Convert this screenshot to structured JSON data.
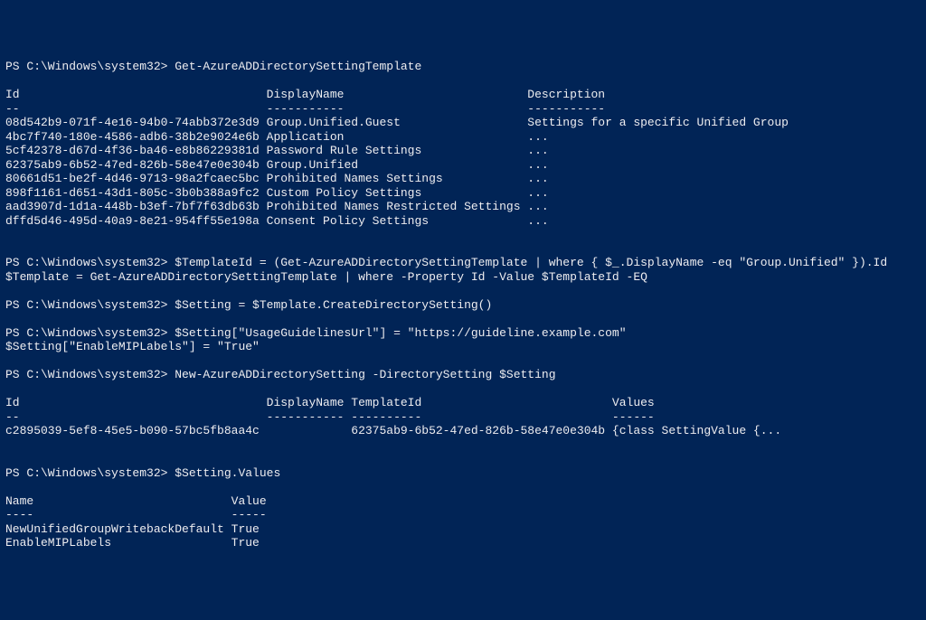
{
  "prompt": "PS C:\\Windows\\system32>",
  "cmd": {
    "c1": "Get-AzureADDirectorySettingTemplate",
    "c2a": "$TemplateId = (Get-AzureADDirectorySettingTemplate | where { $_.DisplayName -eq \"Group.Unified\" }).Id",
    "c2b": "$Template = Get-AzureADDirectorySettingTemplate | where -Property Id -Value $TemplateId -EQ",
    "c3": "$Setting = $Template.CreateDirectorySetting()",
    "c4a": "$Setting[\"UsageGuidelinesUrl\"] = \"https://guideline.example.com\"",
    "c4b": "$Setting[\"EnableMIPLabels\"] = \"True\"",
    "c5": "New-AzureADDirectorySetting -DirectorySetting $Setting",
    "c6": "$Setting.Values"
  },
  "table1": {
    "headers": {
      "id": "Id",
      "dn": "DisplayName",
      "desc": "Description"
    },
    "rows": [
      {
        "id": "08d542b9-071f-4e16-94b0-74abb372e3d9",
        "dn": "Group.Unified.Guest",
        "desc": "Settings for a specific Unified Group"
      },
      {
        "id": "4bc7f740-180e-4586-adb6-38b2e9024e6b",
        "dn": "Application",
        "desc": "..."
      },
      {
        "id": "5cf42378-d67d-4f36-ba46-e8b86229381d",
        "dn": "Password Rule Settings",
        "desc": "..."
      },
      {
        "id": "62375ab9-6b52-47ed-826b-58e47e0e304b",
        "dn": "Group.Unified",
        "desc": "..."
      },
      {
        "id": "80661d51-be2f-4d46-9713-98a2fcaec5bc",
        "dn": "Prohibited Names Settings",
        "desc": "..."
      },
      {
        "id": "898f1161-d651-43d1-805c-3b0b388a9fc2",
        "dn": "Custom Policy Settings",
        "desc": "..."
      },
      {
        "id": "aad3907d-1d1a-448b-b3ef-7bf7f63db63b",
        "dn": "Prohibited Names Restricted Settings",
        "desc": "..."
      },
      {
        "id": "dffd5d46-495d-40a9-8e21-954ff55e198a",
        "dn": "Consent Policy Settings",
        "desc": "..."
      }
    ]
  },
  "table2": {
    "headers": {
      "id": "Id",
      "dn": "DisplayName",
      "tid": "TemplateId",
      "vals": "Values"
    },
    "row": {
      "id": "c2895039-5ef8-45e5-b090-57bc5fb8aa4c",
      "dn": "",
      "tid": "62375ab9-6b52-47ed-826b-58e47e0e304b",
      "vals": "{class SettingValue {..."
    }
  },
  "table3": {
    "headers": {
      "name": "Name",
      "value": "Value"
    },
    "rows": [
      {
        "name": "NewUnifiedGroupWritebackDefault",
        "value": "True"
      },
      {
        "name": "EnableMIPLabels",
        "value": "True"
      }
    ]
  },
  "chart_data": {
    "type": "table",
    "title": "Get-AzureADDirectorySettingTemplate",
    "columns": [
      "Id",
      "DisplayName",
      "Description"
    ],
    "rows": [
      [
        "08d542b9-071f-4e16-94b0-74abb372e3d9",
        "Group.Unified.Guest",
        "Settings for a specific Unified Group"
      ],
      [
        "4bc7f740-180e-4586-adb6-38b2e9024e6b",
        "Application",
        "..."
      ],
      [
        "5cf42378-d67d-4f36-ba46-e8b86229381d",
        "Password Rule Settings",
        "..."
      ],
      [
        "62375ab9-6b52-47ed-826b-58e47e0e304b",
        "Group.Unified",
        "..."
      ],
      [
        "80661d51-be2f-4d46-9713-98a2fcaec5bc",
        "Prohibited Names Settings",
        "..."
      ],
      [
        "898f1161-d651-43d1-805c-3b0b388a9fc2",
        "Custom Policy Settings",
        "..."
      ],
      [
        "aad3907d-1d1a-448b-b3ef-7bf7f63db63b",
        "Prohibited Names Restricted Settings",
        "..."
      ],
      [
        "dffd5d46-495d-40a9-8e21-954ff55e198a",
        "Consent Policy Settings",
        "..."
      ]
    ]
  }
}
